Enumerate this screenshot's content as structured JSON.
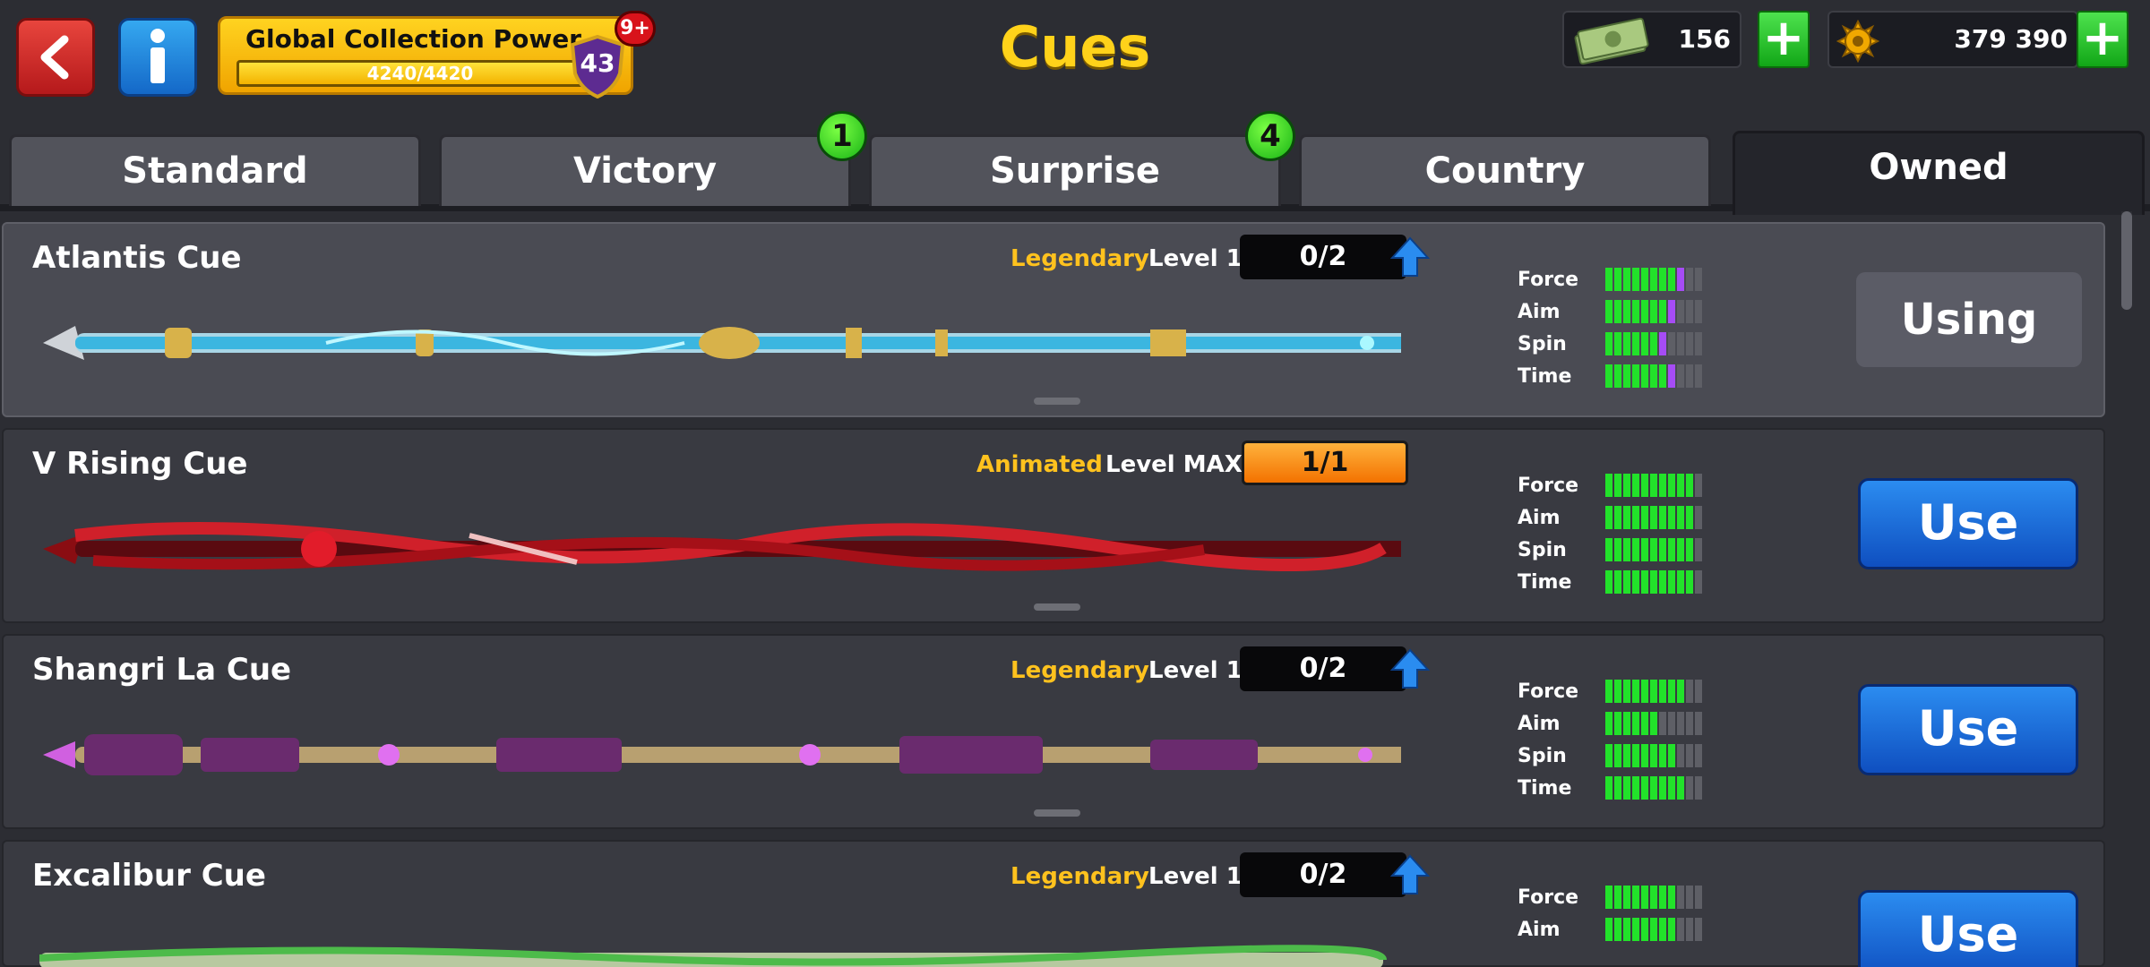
{
  "header": {
    "title": "Cues",
    "back_icon": "back-arrow-icon",
    "info_icon": "info-icon",
    "collection": {
      "label": "Global Collection Power",
      "progress_text": "4240/4420",
      "progress_fraction": 0.959,
      "level": "43",
      "badge": "9+"
    },
    "cash": {
      "icon": "cash-icon",
      "value": "156"
    },
    "coins": {
      "icon": "coin-icon",
      "value": "379 390"
    }
  },
  "tabs": [
    {
      "label": "Standard",
      "badge": ""
    },
    {
      "label": "Victory",
      "badge": "1"
    },
    {
      "label": "Surprise",
      "badge": "4"
    },
    {
      "label": "Country",
      "badge": ""
    },
    {
      "label": "Owned",
      "badge": ""
    }
  ],
  "stat_labels": [
    "Force",
    "Aim",
    "Spin",
    "Time"
  ],
  "cues": [
    {
      "name": "Atlantis Cue",
      "rarity": "Legendary",
      "level": "Level 1",
      "progress": "0/2",
      "button": "Using",
      "stats": [
        8,
        7,
        6,
        7
      ],
      "stats_bonus": [
        1,
        1,
        1,
        1
      ]
    },
    {
      "name": "V Rising Cue",
      "rarity": "Animated",
      "level": "Level MAX",
      "progress": "1/1",
      "button": "Use",
      "stats": [
        10,
        10,
        10,
        10
      ],
      "stats_bonus": [
        0,
        0,
        0,
        0
      ]
    },
    {
      "name": "Shangri La Cue",
      "rarity": "Legendary",
      "level": "Level 1",
      "progress": "0/2",
      "button": "Use",
      "stats": [
        9,
        6,
        8,
        9
      ],
      "stats_bonus": [
        0,
        0,
        0,
        0
      ]
    },
    {
      "name": "Excalibur Cue",
      "rarity": "Legendary",
      "level": "Level 1",
      "progress": "0/2",
      "button": "Use",
      "stats": [
        8,
        8,
        0,
        0
      ],
      "stats_bonus": [
        0,
        0,
        0,
        0
      ]
    }
  ]
}
